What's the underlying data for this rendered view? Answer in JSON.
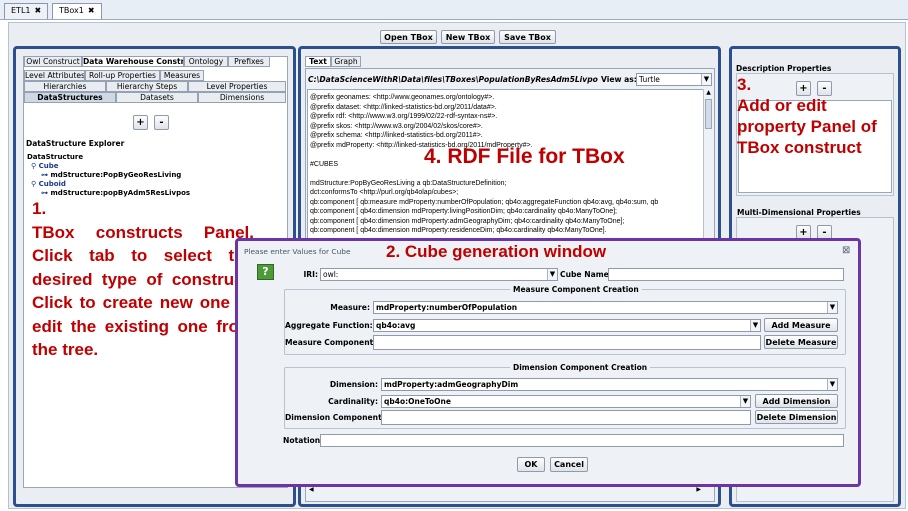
{
  "file_tabs": [
    {
      "label": "ETL1",
      "close": "✖"
    },
    {
      "label": "TBox1",
      "close": "✖"
    }
  ],
  "toolbar": {
    "open": "Open TBox",
    "new": "New TBox",
    "save": "Save TBox"
  },
  "left_panel": {
    "top_tabs": [
      "Owl Construct",
      "Data Warehouse Construct",
      "Ontology",
      "Prefixes"
    ],
    "row1_tabs": [
      "Level Attributes",
      "Roll-up Properties",
      "Measures"
    ],
    "row2_tabs": [
      "Hierarchies",
      "Hierarchy Steps",
      "Level Properties"
    ],
    "row3_tabs": [
      "DataStructures",
      "Datasets",
      "Dimensions"
    ],
    "plus": "+",
    "minus": "-",
    "explorer_title": "DataStructure Explorer",
    "tree": {
      "root": "DataStructure",
      "cube": "Cube",
      "cube_child": "mdStructure:PopByGeoResLiving",
      "cuboid": "Cuboid",
      "cuboid_child": "mdStructure:popByAdm5ResLivpos"
    },
    "annotation": "1.\nTBox constructs Panel. Click tab to select the desired type of construct. Click to create new one or edit the existing one from the tree."
  },
  "center_panel": {
    "tabs": [
      "Text",
      "Graph"
    ],
    "file_path": "C:\\DataScienceWithR\\Data\\files\\TBoxes\\PopulationByResAdm5LivposTargetTBox-1.ttl",
    "view_as_label": "View as:",
    "view_as_value": "Turtle",
    "rdf_lines": [
      "@prefix geonames: <http://www.geonames.org/ontology#>.",
      "@prefix dataset: <http://linked-statistics-bd.org/2011/data#>.",
      "@prefix rdf: <http://www.w3.org/1999/02/22-rdf-syntax-ns#>.",
      "@prefix skos: <http://www.w3.org/2004/02/skos/core#>.",
      "@prefix schema: <http://linked-statistics-bd.org/2011#>.",
      "@prefix mdProperty: <http://linked-statistics-bd.org/2011/mdProperty#>.",
      "",
      "#CUBES",
      "",
      "mdStructure:PopByGeoResLiving a qb:DataStructureDefinition;",
      "            dct:conformsTo <http://purl.org/qb4olap/cubes>;",
      "            qb:component [ qb:measure mdProperty:numberOfPopulation; qb4o:aggregateFunction qb4o:avg, qb4o:sum, qb",
      "            qb:component [ qb4o:dimension mdProperty:livingPositionDim; qb4o:cardinality qb4o:ManyToOne];",
      "            qb:component [ qb4o:dimension mdProperty:admGeographyDim; qb4o:cardinality qb4o:ManyToOne];",
      "            qb:component [ qb4o:dimension mdProperty:residenceDim; qb4o:cardinality qb4o:ManyToOne]."
    ],
    "annotation": "4. RDF File for TBox"
  },
  "right_panel": {
    "desc_title": "Description Properties",
    "plus": "+",
    "minus": "-",
    "annotation": "3.\nAdd or edit property Panel of TBox construct",
    "multi_title": "Multi-Dimensional Properties"
  },
  "dialog": {
    "title": "Please enter Values for Cube",
    "close": "⊠",
    "help_icon": "?",
    "annotation": "2. Cube generation window",
    "iri_label": "IRI:",
    "iri_value": "owl:",
    "cube_name_label": "Cube Name:",
    "cube_name_value": "",
    "measure_section": "Measure Component Creation",
    "measure_label": "Measure:",
    "measure_value": "mdProperty:numberOfPopulation",
    "agg_label": "Aggregate Function:",
    "agg_value": "qb4o:avg",
    "add_measure": "Add Measure",
    "measure_components_label": "Measure Components:",
    "delete_measure": "Delete Measure",
    "dimension_section": "Dimension Component Creation",
    "dimension_label": "Dimension:",
    "dimension_value": "mdProperty:admGeographyDim",
    "cardinality_label": "Cardinality:",
    "cardinality_value": "qb4o:OneToOne",
    "add_dimension": "Add Dimension",
    "dimension_components_label": "Dimension Components:",
    "delete_dimension": "Delete Dimension",
    "notation_label": "Notation:",
    "ok": "OK",
    "cancel": "Cancel"
  }
}
